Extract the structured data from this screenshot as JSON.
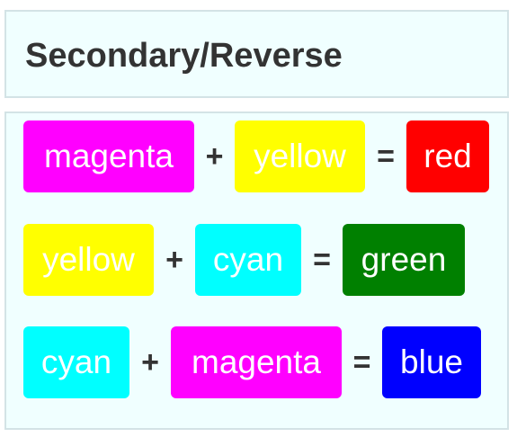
{
  "title": "Secondary/Reverse",
  "operators": {
    "plus": "+",
    "equals": "="
  },
  "rows": [
    {
      "a": {
        "label": "magenta",
        "color": "#ff00ff"
      },
      "b": {
        "label": "yellow",
        "color": "#ffff00"
      },
      "result": {
        "label": "red",
        "color": "#ff0000"
      }
    },
    {
      "a": {
        "label": "yellow",
        "color": "#ffff00"
      },
      "b": {
        "label": "cyan",
        "color": "#00ffff"
      },
      "result": {
        "label": "green",
        "color": "#008000"
      }
    },
    {
      "a": {
        "label": "cyan",
        "color": "#00ffff"
      },
      "b": {
        "label": "magenta",
        "color": "#ff00ff"
      },
      "result": {
        "label": "blue",
        "color": "#0000ff"
      }
    }
  ]
}
